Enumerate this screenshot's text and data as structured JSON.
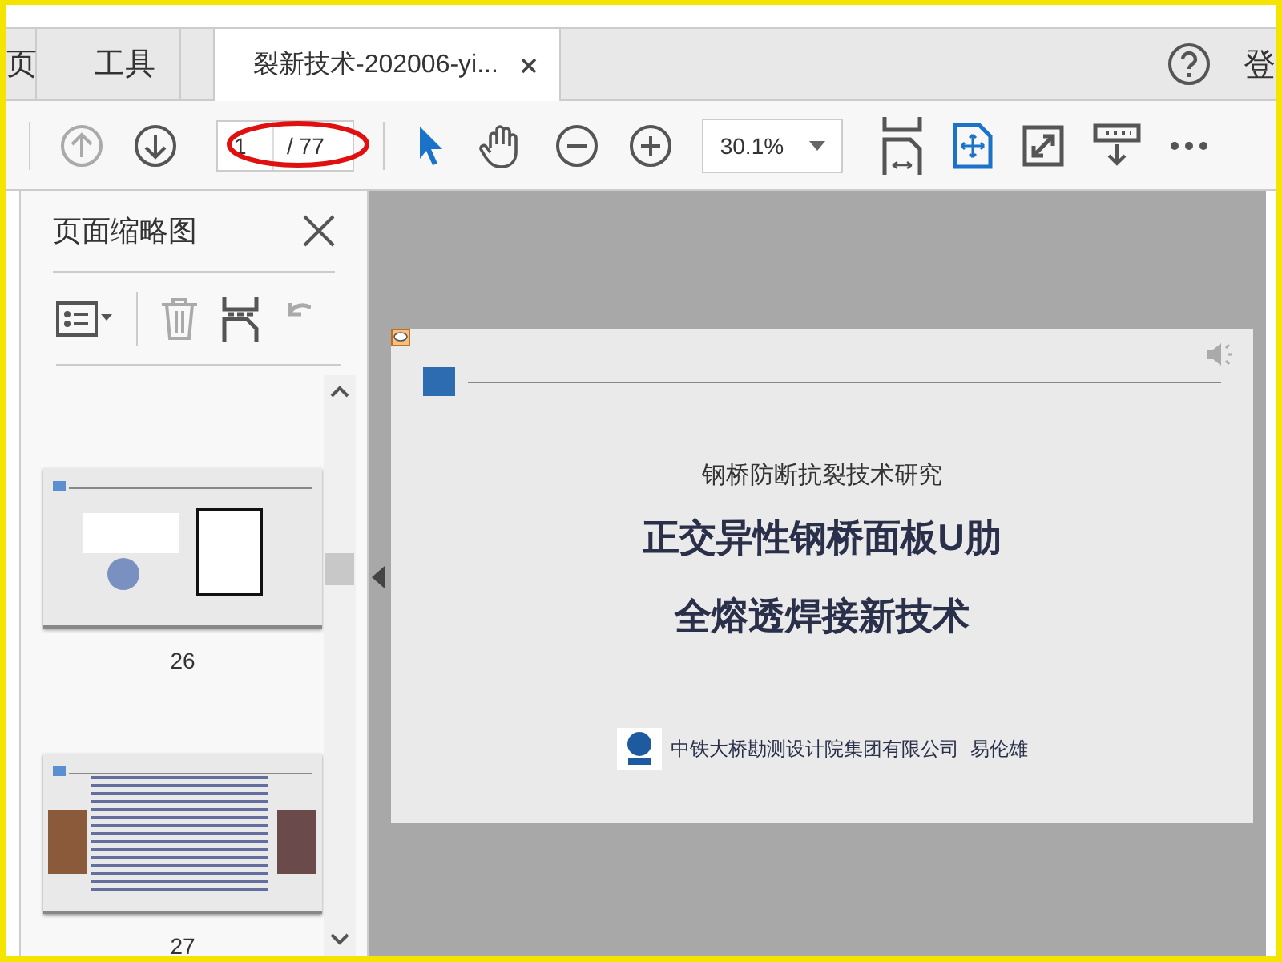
{
  "tabs": [
    {
      "label": "页",
      "selected": false
    },
    {
      "label": "工具",
      "selected": false
    },
    {
      "label": "裂新技术-202006-yi...",
      "selected": true
    }
  ],
  "account_label": "登",
  "toolbar": {
    "page_number": "1",
    "page_total": "/ 77",
    "zoom": "30.1%"
  },
  "sidebar": {
    "title": "页面缩略图",
    "thumbnails": [
      {
        "label": "26",
        "kind": "chart"
      },
      {
        "label": "27",
        "kind": "text"
      }
    ]
  },
  "document": {
    "subtitle": "钢桥防断抗裂技术研究",
    "title_lines": [
      "正交异性钢桥面板U肋",
      "全熔透焊接新技术"
    ],
    "footer": "中铁大桥勘测设计院集团有限公司  易伦雄"
  }
}
